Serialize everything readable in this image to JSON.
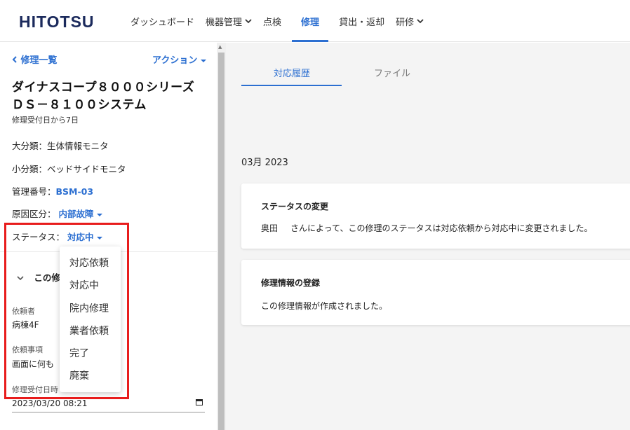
{
  "header": {
    "logo": "HITOTSU",
    "nav": [
      {
        "label": "ダッシュボード",
        "has_chevron": false,
        "active": false
      },
      {
        "label": "機器管理",
        "has_chevron": true,
        "active": false
      },
      {
        "label": "点検",
        "has_chevron": false,
        "active": false
      },
      {
        "label": "修理",
        "has_chevron": false,
        "active": true
      },
      {
        "label": "貸出・返却",
        "has_chevron": false,
        "active": false
      },
      {
        "label": "研修",
        "has_chevron": true,
        "active": false
      }
    ]
  },
  "left": {
    "back_label": "修理一覧",
    "action_label": "アクション",
    "title": "ダイナスコープ８０００シリーズ ＤＳ－８１００システム",
    "subtitle": "修理受付日から7日",
    "major_category": "大分類：生体情報モニタ",
    "minor_category": "小分類：ベッドサイドモニタ",
    "management_number_label": "管理番号：",
    "management_number": "BSM-03",
    "cause_label": "原因区分：",
    "cause_value": "内部故障",
    "status_label": "ステータス：",
    "status_value": "対応中",
    "section_title": "この修",
    "requester_label": "依頼者",
    "requester_value": "病棟4F",
    "request_label": "依頼事項",
    "request_value": "画面に何も",
    "received_label": "修理受付日時",
    "received_value": "2023/03/20 08:21"
  },
  "status_dropdown": {
    "options": [
      "対応依頼",
      "対応中",
      "院内修理",
      "業者依頼",
      "完了",
      "廃棄"
    ]
  },
  "right": {
    "tabs": [
      "対応履歴",
      "ファイル"
    ],
    "active_tab": 0,
    "month": "03月 2023",
    "history": [
      {
        "title": "ステータスの変更",
        "user": "奥田",
        "body": "さんによって、この修理のステータスは対応依頼から対応中に変更されました。"
      },
      {
        "title": "修理情報の登録",
        "user": "",
        "body": "この修理情報が作成されました。"
      }
    ]
  },
  "colors": {
    "accent": "#2c6fd1",
    "logo": "#1b2a5c",
    "highlight_box": "#e81c1c",
    "right_bg": "#f4f4f4"
  }
}
